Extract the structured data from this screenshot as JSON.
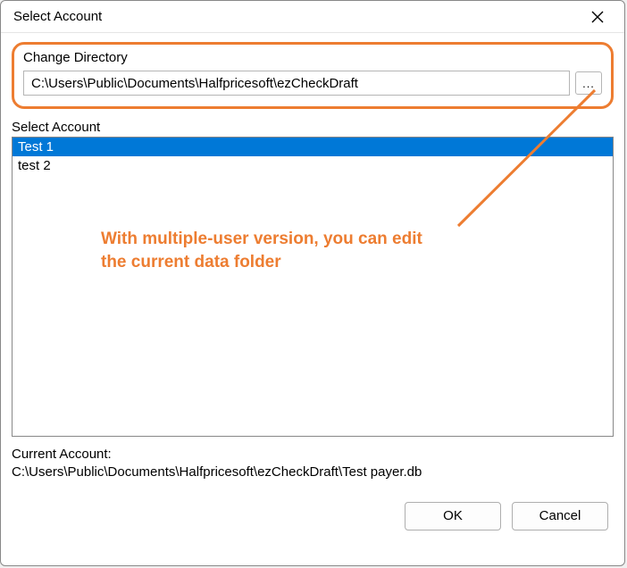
{
  "title": "Select Account",
  "changeDirectory": {
    "label": "Change Directory",
    "path": "C:\\Users\\Public\\Documents\\Halfpricesoft\\ezCheckDraft",
    "browseLabel": "..."
  },
  "selectAccount": {
    "label": "Select Account",
    "items": [
      {
        "label": "Test 1",
        "selected": true
      },
      {
        "label": "test 2",
        "selected": false
      }
    ]
  },
  "annotation": {
    "line1": "With multiple-user version, you can edit",
    "line2": "the current data folder"
  },
  "currentAccount": {
    "label": "Current Account:",
    "path": "C:\\Users\\Public\\Documents\\Halfpricesoft\\ezCheckDraft\\Test payer.db"
  },
  "buttons": {
    "ok": "OK",
    "cancel": "Cancel"
  },
  "colors": {
    "highlight": "#ed7d31",
    "selection": "#0078d7"
  }
}
